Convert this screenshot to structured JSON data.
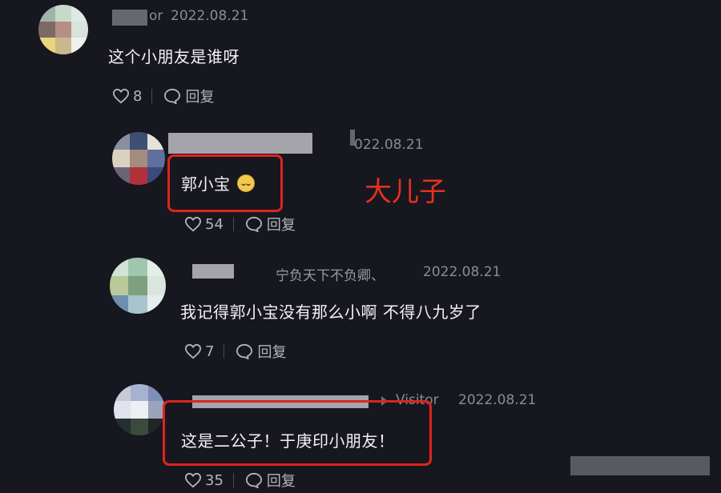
{
  "comments": [
    {
      "user_fragment": "or",
      "date": "2022.08.21",
      "text": "这个小朋友是谁呀",
      "likes": "8",
      "reply_label": "回复"
    },
    {
      "user_fragment": "022.08.21",
      "text": "郭小宝",
      "likes": "54",
      "reply_label": "回复"
    },
    {
      "reply_to": "宁负天下不负卿、",
      "date": "2022.08.21",
      "text": "我记得郭小宝没有那么小啊 不得八九岁了",
      "likes": "7",
      "reply_label": "回复"
    },
    {
      "user_fragment": "Visitor",
      "date": "2022.08.21",
      "text": "这是二公子！于庚印小朋友！",
      "likes": "35",
      "reply_label": "回复"
    }
  ],
  "annotation": "大儿子",
  "icons": {
    "like": "heart-icon",
    "reply": "comment-bubble-icon",
    "reply_arrow": "reply-arrow-icon"
  },
  "colors": {
    "background": "#17171f",
    "highlight_box": "#e0241c",
    "annotation": "#e8301f"
  }
}
